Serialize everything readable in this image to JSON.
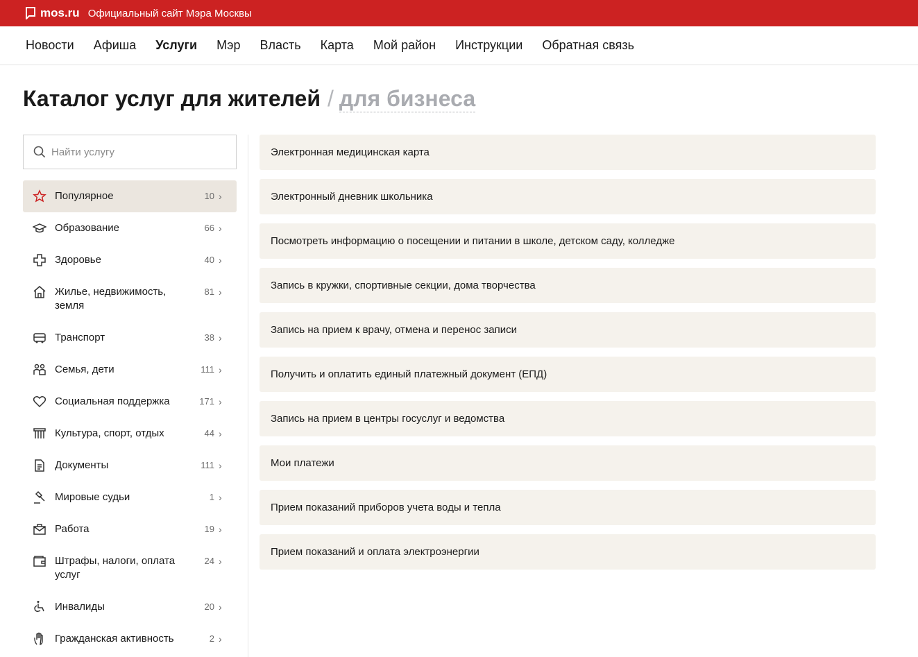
{
  "header": {
    "logo": "mos.ru",
    "site_title": "Официальный сайт Мэра Москвы",
    "brand_color": "#cc2222"
  },
  "nav": [
    {
      "label": "Новости",
      "active": false
    },
    {
      "label": "Афиша",
      "active": false
    },
    {
      "label": "Услуги",
      "active": true
    },
    {
      "label": "Мэр",
      "active": false
    },
    {
      "label": "Власть",
      "active": false
    },
    {
      "label": "Карта",
      "active": false
    },
    {
      "label": "Мой район",
      "active": false
    },
    {
      "label": "Инструкции",
      "active": false
    },
    {
      "label": "Обратная связь",
      "active": false
    }
  ],
  "page": {
    "title": "Каталог услуг для жителей",
    "slash": "/",
    "alt_link": "для бизнеса"
  },
  "search": {
    "placeholder": "Найти услугу"
  },
  "categories": [
    {
      "label": "Популярное",
      "count": "10",
      "icon": "star-icon",
      "active": true
    },
    {
      "label": "Образование",
      "count": "66",
      "icon": "graduation-cap-icon"
    },
    {
      "label": "Здоровье",
      "count": "40",
      "icon": "medical-cross-icon"
    },
    {
      "label": "Жилье, недвижимость, земля",
      "count": "81",
      "icon": "house-icon"
    },
    {
      "label": "Транспорт",
      "count": "38",
      "icon": "bus-icon"
    },
    {
      "label": "Семья, дети",
      "count": "111",
      "icon": "family-icon"
    },
    {
      "label": "Социальная поддержка",
      "count": "171",
      "icon": "heart-icon"
    },
    {
      "label": "Культура, спорт, отдых",
      "count": "44",
      "icon": "theater-icon"
    },
    {
      "label": "Документы",
      "count": "111",
      "icon": "document-icon"
    },
    {
      "label": "Мировые судьи",
      "count": "1",
      "icon": "gavel-icon"
    },
    {
      "label": "Работа",
      "count": "19",
      "icon": "briefcase-icon"
    },
    {
      "label": "Штрафы, налоги, оплата услуг",
      "count": "24",
      "icon": "wallet-icon"
    },
    {
      "label": "Инвалиды",
      "count": "20",
      "icon": "wheelchair-icon"
    },
    {
      "label": "Гражданская активность",
      "count": "2",
      "icon": "hand-icon"
    }
  ],
  "services": [
    "Электронная медицинская карта",
    "Электронный дневник школьника",
    "Посмотреть информацию о посещении и питании в школе, детском саду, колледже",
    "Запись в кружки, спортивные секции, дома творчества",
    "Запись на прием к врачу, отмена и перенос записи",
    "Получить и оплатить единый платежный документ (ЕПД)",
    "Запись на прием в центры госуслуг и ведомства",
    "Мои платежи",
    "Прием показаний приборов учета воды и тепла",
    "Прием показаний и оплата электроэнергии"
  ]
}
